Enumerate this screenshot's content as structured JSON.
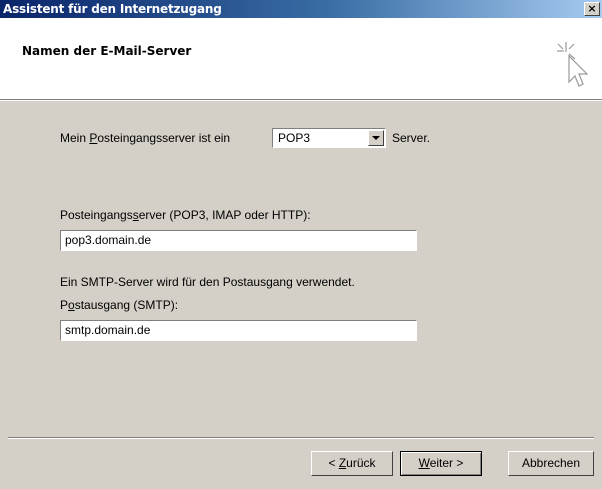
{
  "window": {
    "title": "Assistent für den Internetzugang",
    "close_glyph": "×"
  },
  "header": {
    "title": "Namen der E-Mail-Server",
    "icon": "wizard-cursor-icon"
  },
  "incoming_type": {
    "label_pre": "Mein ",
    "label_accel": "P",
    "label_post": "osteingangsserver ist ein",
    "value": "POP3",
    "suffix": "Server."
  },
  "incoming_server": {
    "label_pre": "Posteingangs",
    "label_accel": "s",
    "label_post": "erver (POP3, IMAP oder HTTP):",
    "value": "pop3.domain.de"
  },
  "outgoing_server": {
    "info": "Ein SMTP-Server wird für den Postausgang verwendet.",
    "label_pre": "P",
    "label_accel": "o",
    "label_post": "stausgang (SMTP):",
    "value": "smtp.domain.de"
  },
  "buttons": {
    "back_pre": "< ",
    "back_accel": "Z",
    "back_post": "urück",
    "next_accel": "W",
    "next_post": "eiter >",
    "cancel": "Abbrechen"
  }
}
